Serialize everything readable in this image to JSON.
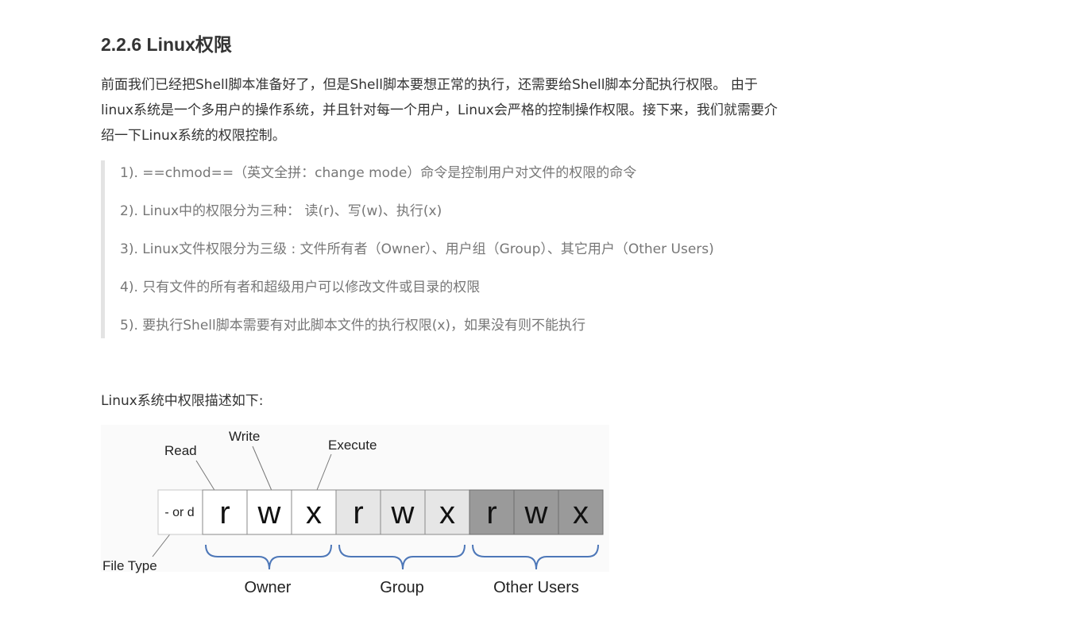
{
  "section": {
    "heading": "2.2.6 Linux权限"
  },
  "intro": {
    "line1": "前面我们已经把Shell脚本准备好了，但是Shell脚本要想正常的执行，还需要给Shell脚本分配执行权限。 由于",
    "line2": "linux系统是一个多用户的操作系统，并且针对每一个用户，Linux会严格的控制操作权限。接下来，我们就需要介",
    "line3": "绍一下Linux系统的权限控制。"
  },
  "notes": [
    "1). ==chmod==（英文全拼：change mode）命令是控制用户对文件的权限的命令",
    "2). Linux中的权限分为三种： 读(r)、写(w)、执行(x)",
    "3). Linux文件权限分为三级 : 文件所有者（Owner）、用户组（Group）、其它用户（Other Users)",
    "4). 只有文件的所有者和超级用户可以修改文件或目录的权限",
    "5). 要执行Shell脚本需要有对此脚本文件的执行权限(x)，如果没有则不能执行"
  ],
  "description": "Linux系统中权限描述如下:",
  "figure": {
    "annotations": {
      "read": "Read",
      "write": "Write",
      "execute": "Execute",
      "file_type": "File Type"
    },
    "file_type_cell": "- or d",
    "owner_cells": [
      "r",
      "w",
      "x"
    ],
    "group_cells": [
      "r",
      "w",
      "x"
    ],
    "other_cells": [
      "r",
      "w",
      "x"
    ],
    "groups": {
      "owner": "Owner",
      "group": "Group",
      "other": "Other Users"
    },
    "colors": {
      "owner_fill": "#ffffff",
      "group_fill": "#e6e6e6",
      "other_fill": "#9a9a9a",
      "brace": "#4d77b8",
      "cell_border": "#8a8a8a"
    }
  }
}
